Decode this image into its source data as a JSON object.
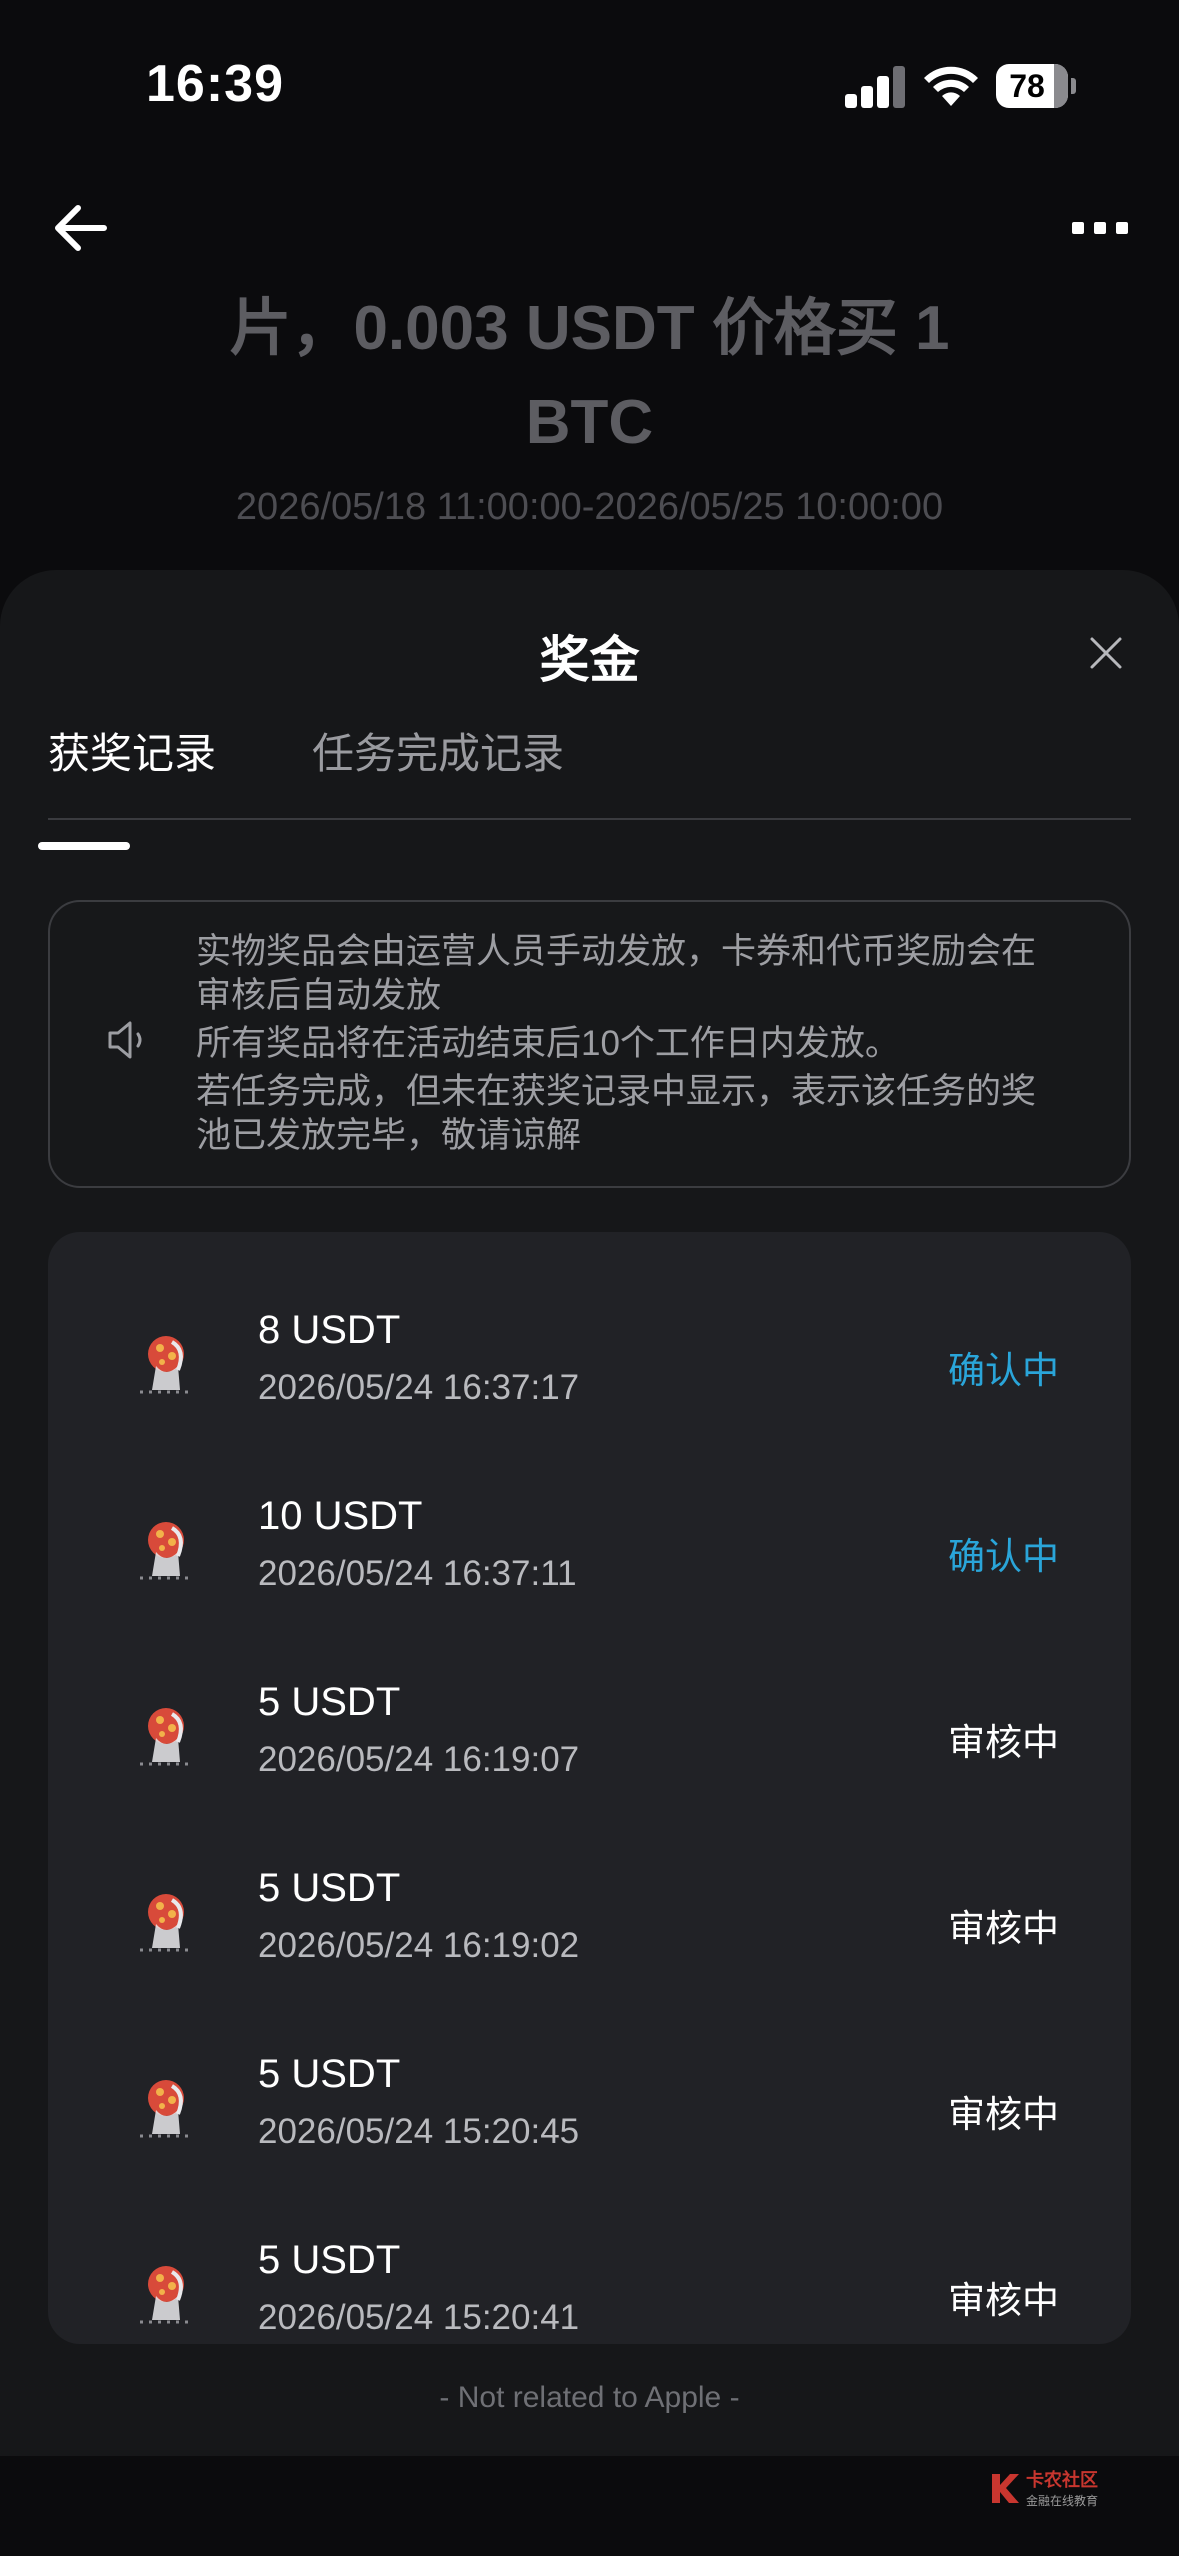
{
  "status_bar": {
    "time": "16:39",
    "battery": "78"
  },
  "background": {
    "title": "片，0.003 USDT 价格买 1\nBTC",
    "date_range": "2026/05/18 11:00:00-2026/05/25 10:00:00"
  },
  "sheet": {
    "title": "奖金",
    "tabs": [
      {
        "label": "获奖记录",
        "active": true
      },
      {
        "label": "任务完成记录",
        "active": false
      }
    ],
    "notice": {
      "lines": [
        "实物奖品会由运营人员手动发放，卡券和代币奖励会在审核后自动发放",
        "所有奖品将在活动结束后10个工作日内发放。",
        "若任务完成，但未在获奖记录中显示，表示该任务的奖池已发放完毕，敬请谅解"
      ]
    },
    "records": [
      {
        "amount": "8 USDT",
        "time": "2026/05/24 16:37:17",
        "status": "确认中",
        "status_color": "#2aa5d9"
      },
      {
        "amount": "10 USDT",
        "time": "2026/05/24 16:37:11",
        "status": "确认中",
        "status_color": "#2aa5d9"
      },
      {
        "amount": "5 USDT",
        "time": "2026/05/24 16:19:07",
        "status": "审核中",
        "status_color": "#ffffff"
      },
      {
        "amount": "5 USDT",
        "time": "2026/05/24 16:19:02",
        "status": "审核中",
        "status_color": "#ffffff"
      },
      {
        "amount": "5 USDT",
        "time": "2026/05/24 15:20:45",
        "status": "审核中",
        "status_color": "#ffffff"
      },
      {
        "amount": "5 USDT",
        "time": "2026/05/24 15:20:41",
        "status": "审核中",
        "status_color": "#ffffff"
      }
    ],
    "footer_note": "- Not related to Apple -"
  },
  "watermark": {
    "main": "卡农社区",
    "sub": "金融在线教育"
  },
  "icons": {
    "back": "arrow-left-icon",
    "more": "more-horizontal-icon",
    "close": "close-icon",
    "notice": "speaker-icon",
    "reward": "reward-badge-icon"
  },
  "colors": {
    "accent": "#2aa5d9",
    "sheet_bg": "#161719",
    "card_bg": "#212226"
  }
}
